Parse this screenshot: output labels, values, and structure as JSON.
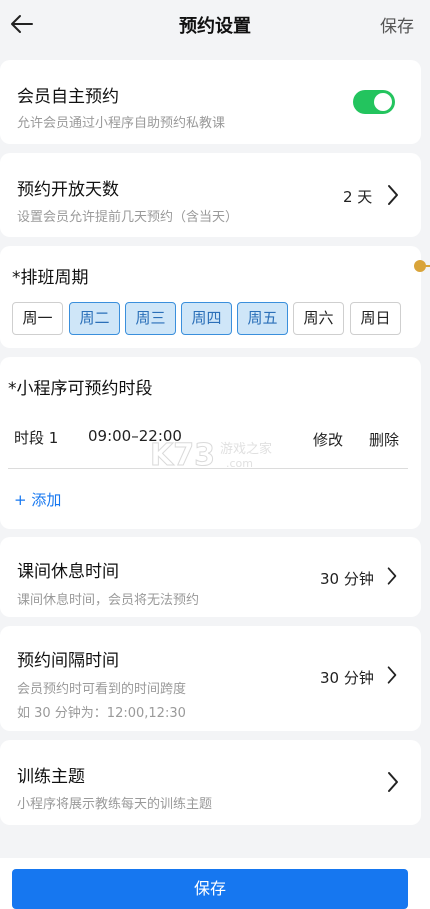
{
  "header": {
    "title": "预约设置",
    "save_label": "保存"
  },
  "self_booking": {
    "title": "会员自主预约",
    "subtitle": "允许会员通过小程序自助预约私教课",
    "enabled": true
  },
  "open_days": {
    "title": "预约开放天数",
    "subtitle": "设置会员允许提前几天预约（含当天）",
    "value": "2 天"
  },
  "schedule": {
    "title": "*排班周期",
    "days": [
      {
        "label": "周一",
        "active": false
      },
      {
        "label": "周二",
        "active": true
      },
      {
        "label": "周三",
        "active": true
      },
      {
        "label": "周四",
        "active": true
      },
      {
        "label": "周五",
        "active": true
      },
      {
        "label": "周六",
        "active": false
      },
      {
        "label": "周日",
        "active": false
      }
    ]
  },
  "time_slots": {
    "title": "*小程序可预约时段",
    "slots": [
      {
        "name": "时段 1",
        "range": "09:00–22:00",
        "edit_label": "修改",
        "delete_label": "删除"
      }
    ],
    "add_label": "+ 添加"
  },
  "break_time": {
    "title": "课间休息时间",
    "subtitle": "课间休息时间，会员将无法预约",
    "value": "30 分钟"
  },
  "interval": {
    "title": "预约间隔时间",
    "subtitle": "会员预约时可看到的时间跨度",
    "example": "如 30 分钟为：12:00,12:30",
    "value": "30 分钟"
  },
  "theme": {
    "title": "训练主题",
    "subtitle": "小程序将展示教练每天的训练主题"
  },
  "footer": {
    "save_label": "保存"
  },
  "colors": {
    "toggle_on": "#23c45e",
    "primary": "#1677f0",
    "active_day_bg": "#cfe6f8",
    "active_day_border": "#3a8fdc"
  },
  "icons": {
    "back": "arrow-left-icon",
    "chevron": "chevron-right-icon"
  }
}
